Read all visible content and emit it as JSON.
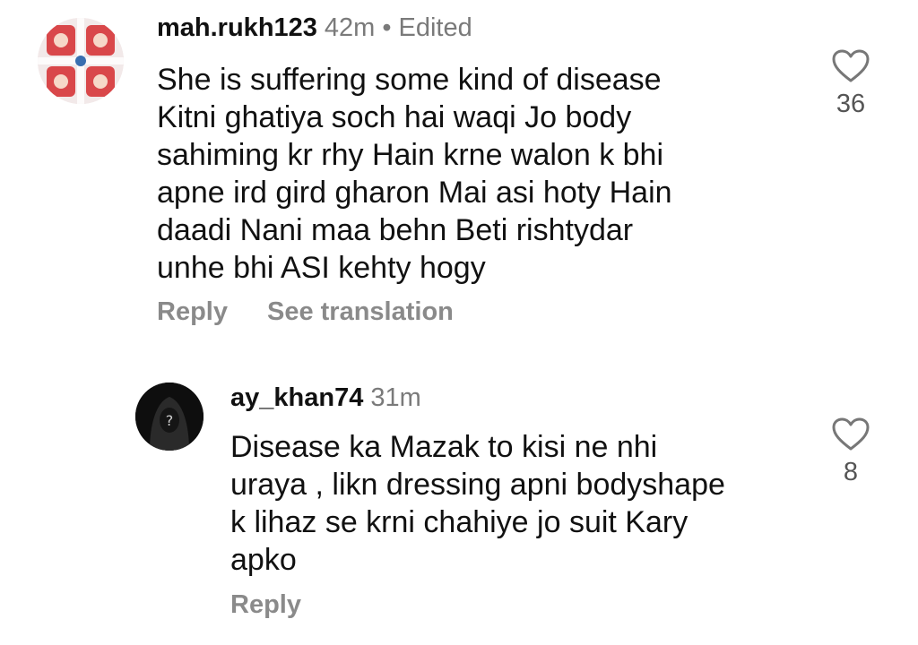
{
  "comments": [
    {
      "username": "mah.rukh123",
      "time": "42m",
      "edited_label": "Edited",
      "text": "She is suffering  some kind of disease\nKitni ghatiya soch hai waqi  Jo body\nsahiming kr rhy Hain krne walon k bhi\napne ird gird gharon Mai asi hoty Hain\ndaadi Nani  maa behn Beti rishtydar\nunhe bhi ASI kehty hogy",
      "reply_label": "Reply",
      "translate_label": "See translation",
      "likes": "36",
      "avatar_icon": "floral-pattern-avatar",
      "like_icon": "heart-outline-icon"
    },
    {
      "username": "ay_khan74",
      "time": "31m",
      "text": "Disease ka Mazak to kisi ne nhi\nuraya , likn dressing apni bodyshape\nk lihaz se krni chahiye jo suit Kary\napko",
      "reply_label": "Reply",
      "likes": "8",
      "avatar_icon": "hooded-figure-avatar",
      "like_icon": "heart-outline-icon"
    }
  ],
  "colors": {
    "text": "#111111",
    "meta": "#7a7a7a",
    "action": "#8a8a8a",
    "avatar_pattern_red": "#d9474a",
    "avatar_pattern_bg": "#f2e9e9"
  }
}
